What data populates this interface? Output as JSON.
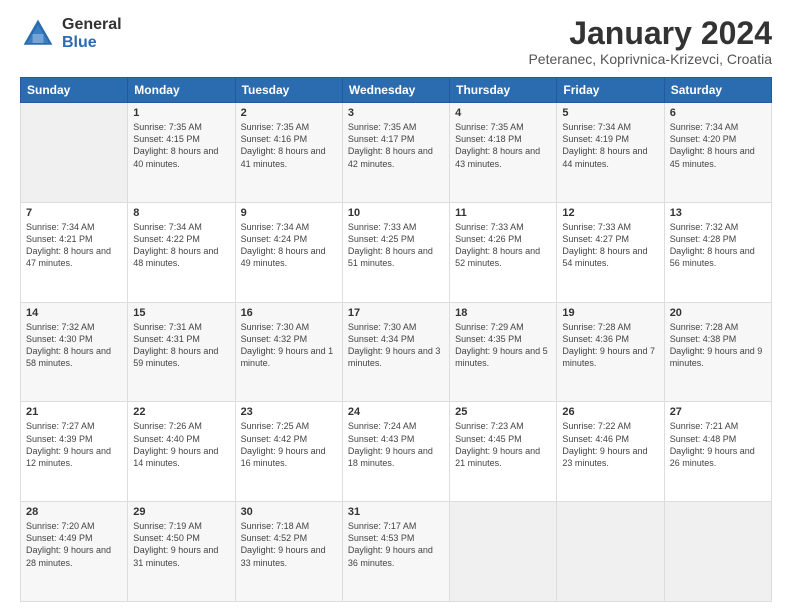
{
  "logo": {
    "general": "General",
    "blue": "Blue"
  },
  "title": "January 2024",
  "location": "Peteranec, Koprivnica-Krizevci, Croatia",
  "days_header": [
    "Sunday",
    "Monday",
    "Tuesday",
    "Wednesday",
    "Thursday",
    "Friday",
    "Saturday"
  ],
  "weeks": [
    [
      {
        "day": "",
        "empty": true
      },
      {
        "day": "1",
        "sunrise": "Sunrise: 7:35 AM",
        "sunset": "Sunset: 4:15 PM",
        "daylight": "Daylight: 8 hours and 40 minutes."
      },
      {
        "day": "2",
        "sunrise": "Sunrise: 7:35 AM",
        "sunset": "Sunset: 4:16 PM",
        "daylight": "Daylight: 8 hours and 41 minutes."
      },
      {
        "day": "3",
        "sunrise": "Sunrise: 7:35 AM",
        "sunset": "Sunset: 4:17 PM",
        "daylight": "Daylight: 8 hours and 42 minutes."
      },
      {
        "day": "4",
        "sunrise": "Sunrise: 7:35 AM",
        "sunset": "Sunset: 4:18 PM",
        "daylight": "Daylight: 8 hours and 43 minutes."
      },
      {
        "day": "5",
        "sunrise": "Sunrise: 7:34 AM",
        "sunset": "Sunset: 4:19 PM",
        "daylight": "Daylight: 8 hours and 44 minutes."
      },
      {
        "day": "6",
        "sunrise": "Sunrise: 7:34 AM",
        "sunset": "Sunset: 4:20 PM",
        "daylight": "Daylight: 8 hours and 45 minutes."
      }
    ],
    [
      {
        "day": "7",
        "sunrise": "Sunrise: 7:34 AM",
        "sunset": "Sunset: 4:21 PM",
        "daylight": "Daylight: 8 hours and 47 minutes."
      },
      {
        "day": "8",
        "sunrise": "Sunrise: 7:34 AM",
        "sunset": "Sunset: 4:22 PM",
        "daylight": "Daylight: 8 hours and 48 minutes."
      },
      {
        "day": "9",
        "sunrise": "Sunrise: 7:34 AM",
        "sunset": "Sunset: 4:24 PM",
        "daylight": "Daylight: 8 hours and 49 minutes."
      },
      {
        "day": "10",
        "sunrise": "Sunrise: 7:33 AM",
        "sunset": "Sunset: 4:25 PM",
        "daylight": "Daylight: 8 hours and 51 minutes."
      },
      {
        "day": "11",
        "sunrise": "Sunrise: 7:33 AM",
        "sunset": "Sunset: 4:26 PM",
        "daylight": "Daylight: 8 hours and 52 minutes."
      },
      {
        "day": "12",
        "sunrise": "Sunrise: 7:33 AM",
        "sunset": "Sunset: 4:27 PM",
        "daylight": "Daylight: 8 hours and 54 minutes."
      },
      {
        "day": "13",
        "sunrise": "Sunrise: 7:32 AM",
        "sunset": "Sunset: 4:28 PM",
        "daylight": "Daylight: 8 hours and 56 minutes."
      }
    ],
    [
      {
        "day": "14",
        "sunrise": "Sunrise: 7:32 AM",
        "sunset": "Sunset: 4:30 PM",
        "daylight": "Daylight: 8 hours and 58 minutes."
      },
      {
        "day": "15",
        "sunrise": "Sunrise: 7:31 AM",
        "sunset": "Sunset: 4:31 PM",
        "daylight": "Daylight: 8 hours and 59 minutes."
      },
      {
        "day": "16",
        "sunrise": "Sunrise: 7:30 AM",
        "sunset": "Sunset: 4:32 PM",
        "daylight": "Daylight: 9 hours and 1 minute."
      },
      {
        "day": "17",
        "sunrise": "Sunrise: 7:30 AM",
        "sunset": "Sunset: 4:34 PM",
        "daylight": "Daylight: 9 hours and 3 minutes."
      },
      {
        "day": "18",
        "sunrise": "Sunrise: 7:29 AM",
        "sunset": "Sunset: 4:35 PM",
        "daylight": "Daylight: 9 hours and 5 minutes."
      },
      {
        "day": "19",
        "sunrise": "Sunrise: 7:28 AM",
        "sunset": "Sunset: 4:36 PM",
        "daylight": "Daylight: 9 hours and 7 minutes."
      },
      {
        "day": "20",
        "sunrise": "Sunrise: 7:28 AM",
        "sunset": "Sunset: 4:38 PM",
        "daylight": "Daylight: 9 hours and 9 minutes."
      }
    ],
    [
      {
        "day": "21",
        "sunrise": "Sunrise: 7:27 AM",
        "sunset": "Sunset: 4:39 PM",
        "daylight": "Daylight: 9 hours and 12 minutes."
      },
      {
        "day": "22",
        "sunrise": "Sunrise: 7:26 AM",
        "sunset": "Sunset: 4:40 PM",
        "daylight": "Daylight: 9 hours and 14 minutes."
      },
      {
        "day": "23",
        "sunrise": "Sunrise: 7:25 AM",
        "sunset": "Sunset: 4:42 PM",
        "daylight": "Daylight: 9 hours and 16 minutes."
      },
      {
        "day": "24",
        "sunrise": "Sunrise: 7:24 AM",
        "sunset": "Sunset: 4:43 PM",
        "daylight": "Daylight: 9 hours and 18 minutes."
      },
      {
        "day": "25",
        "sunrise": "Sunrise: 7:23 AM",
        "sunset": "Sunset: 4:45 PM",
        "daylight": "Daylight: 9 hours and 21 minutes."
      },
      {
        "day": "26",
        "sunrise": "Sunrise: 7:22 AM",
        "sunset": "Sunset: 4:46 PM",
        "daylight": "Daylight: 9 hours and 23 minutes."
      },
      {
        "day": "27",
        "sunrise": "Sunrise: 7:21 AM",
        "sunset": "Sunset: 4:48 PM",
        "daylight": "Daylight: 9 hours and 26 minutes."
      }
    ],
    [
      {
        "day": "28",
        "sunrise": "Sunrise: 7:20 AM",
        "sunset": "Sunset: 4:49 PM",
        "daylight": "Daylight: 9 hours and 28 minutes."
      },
      {
        "day": "29",
        "sunrise": "Sunrise: 7:19 AM",
        "sunset": "Sunset: 4:50 PM",
        "daylight": "Daylight: 9 hours and 31 minutes."
      },
      {
        "day": "30",
        "sunrise": "Sunrise: 7:18 AM",
        "sunset": "Sunset: 4:52 PM",
        "daylight": "Daylight: 9 hours and 33 minutes."
      },
      {
        "day": "31",
        "sunrise": "Sunrise: 7:17 AM",
        "sunset": "Sunset: 4:53 PM",
        "daylight": "Daylight: 9 hours and 36 minutes."
      },
      {
        "day": "",
        "empty": true
      },
      {
        "day": "",
        "empty": true
      },
      {
        "day": "",
        "empty": true
      }
    ]
  ]
}
